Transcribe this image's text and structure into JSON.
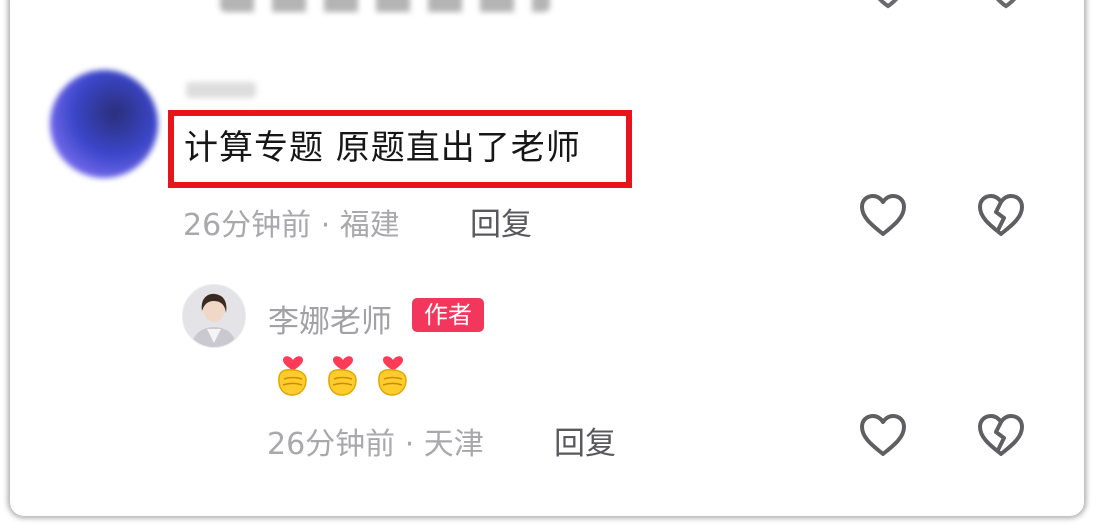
{
  "comment1": {
    "text": "计算专题 原题直出了老师",
    "time_location": "26分钟前 · 福建",
    "reply_label": "回复"
  },
  "reply1": {
    "author": "李娜老师",
    "badge": "作者",
    "emoji_count": 3,
    "time_location": "26分钟前 · 天津",
    "reply_label": "回复"
  },
  "colors": {
    "highlight": "#e8141c",
    "badge": "#f3365c",
    "meta_text": "#a9a9ad"
  },
  "icons": [
    "heart-outline-icon",
    "broken-heart-icon",
    "finger-heart-emoji"
  ]
}
